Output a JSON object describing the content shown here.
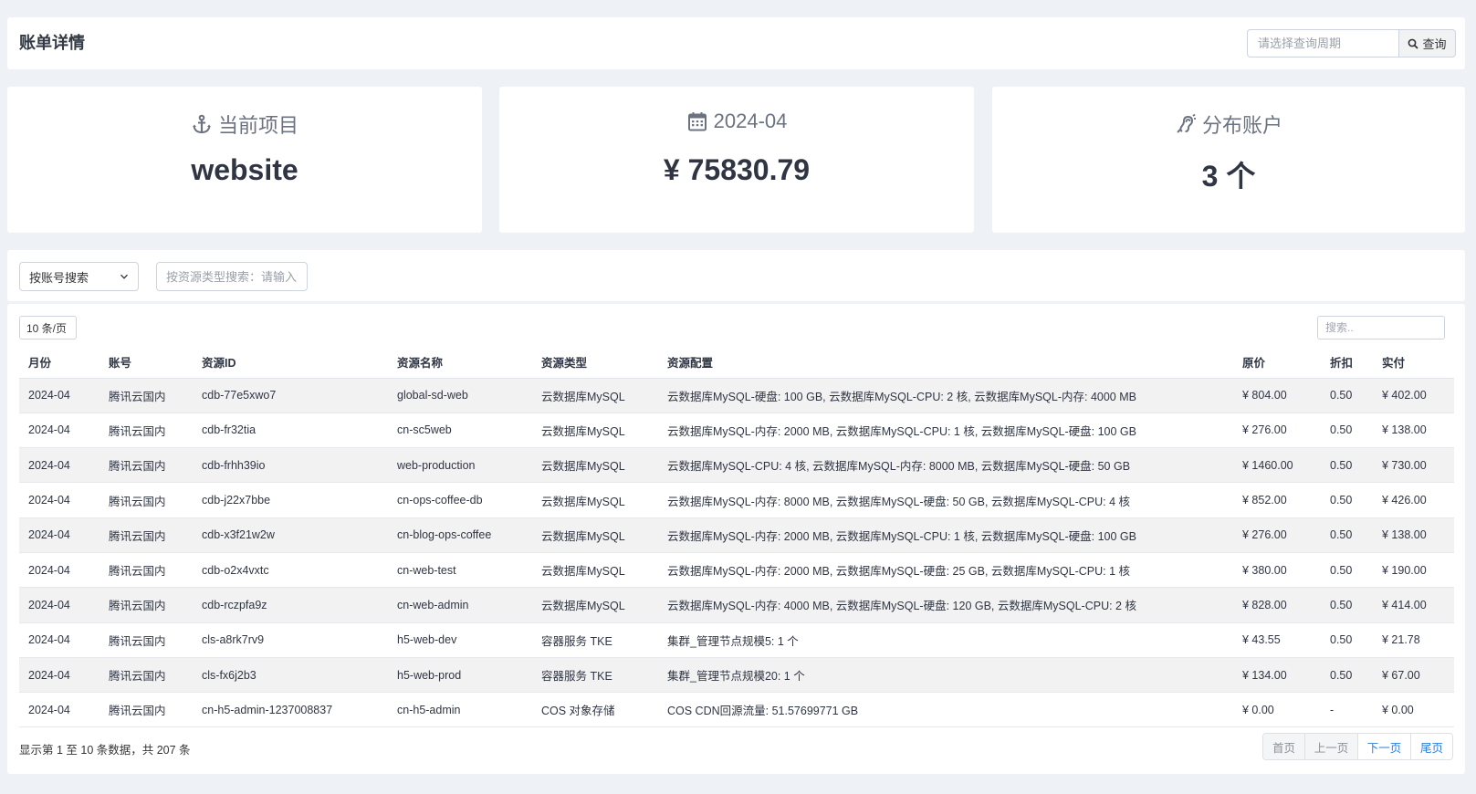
{
  "header": {
    "title": "账单详情",
    "period_placeholder": "请选择查询周期",
    "query_label": "查询",
    "query_icon": "search-icon"
  },
  "cards": {
    "project": {
      "icon": "anchor-icon",
      "label": "当前项目",
      "value": "website"
    },
    "month": {
      "icon": "calendar-icon",
      "label": "2024-04",
      "value": "¥ 75830.79"
    },
    "accounts": {
      "icon": "hearing-icon",
      "label": "分布账户",
      "value": "3 个"
    }
  },
  "filters": {
    "account_select": "按账号搜索",
    "resource_type_placeholder": "按资源类型搜索：请输入资源类型"
  },
  "table": {
    "page_size": "10 条/页",
    "search_placeholder": "搜索..",
    "columns": [
      "月份",
      "账号",
      "资源ID",
      "资源名称",
      "资源类型",
      "资源配置",
      "原价",
      "折扣",
      "实付"
    ],
    "rows": [
      [
        "2024-04",
        "腾讯云国内",
        "cdb-77e5xwo7",
        "global-sd-web",
        "云数据库MySQL",
        "云数据库MySQL-硬盘: 100 GB, 云数据库MySQL-CPU: 2 核, 云数据库MySQL-内存: 4000 MB",
        "¥ 804.00",
        "0.50",
        "¥ 402.00"
      ],
      [
        "2024-04",
        "腾讯云国内",
        "cdb-fr32tia",
        "cn-sc5web",
        "云数据库MySQL",
        "云数据库MySQL-内存: 2000 MB, 云数据库MySQL-CPU: 1 核, 云数据库MySQL-硬盘: 100 GB",
        "¥ 276.00",
        "0.50",
        "¥ 138.00"
      ],
      [
        "2024-04",
        "腾讯云国内",
        "cdb-frhh39io",
        "web-production",
        "云数据库MySQL",
        "云数据库MySQL-CPU: 4 核, 云数据库MySQL-内存: 8000 MB, 云数据库MySQL-硬盘: 50 GB",
        "¥ 1460.00",
        "0.50",
        "¥ 730.00"
      ],
      [
        "2024-04",
        "腾讯云国内",
        "cdb-j22x7bbe",
        "cn-ops-coffee-db",
        "云数据库MySQL",
        "云数据库MySQL-内存: 8000 MB, 云数据库MySQL-硬盘: 50 GB, 云数据库MySQL-CPU: 4 核",
        "¥ 852.00",
        "0.50",
        "¥ 426.00"
      ],
      [
        "2024-04",
        "腾讯云国内",
        "cdb-x3f21w2w",
        "cn-blog-ops-coffee",
        "云数据库MySQL",
        "云数据库MySQL-内存: 2000 MB, 云数据库MySQL-CPU: 1 核, 云数据库MySQL-硬盘: 100 GB",
        "¥ 276.00",
        "0.50",
        "¥ 138.00"
      ],
      [
        "2024-04",
        "腾讯云国内",
        "cdb-o2x4vxtc",
        "cn-web-test",
        "云数据库MySQL",
        "云数据库MySQL-内存: 2000 MB, 云数据库MySQL-硬盘: 25 GB, 云数据库MySQL-CPU: 1 核",
        "¥ 380.00",
        "0.50",
        "¥ 190.00"
      ],
      [
        "2024-04",
        "腾讯云国内",
        "cdb-rczpfa9z",
        "cn-web-admin",
        "云数据库MySQL",
        "云数据库MySQL-内存: 4000 MB, 云数据库MySQL-硬盘: 120 GB, 云数据库MySQL-CPU: 2 核",
        "¥ 828.00",
        "0.50",
        "¥ 414.00"
      ],
      [
        "2024-04",
        "腾讯云国内",
        "cls-a8rk7rv9",
        "h5-web-dev",
        "容器服务 TKE",
        "集群_管理节点规模5: 1 个",
        "¥ 43.55",
        "0.50",
        "¥ 21.78"
      ],
      [
        "2024-04",
        "腾讯云国内",
        "cls-fx6j2b3",
        "h5-web-prod",
        "容器服务 TKE",
        "集群_管理节点规模20: 1 个",
        "¥ 134.00",
        "0.50",
        "¥ 67.00"
      ],
      [
        "2024-04",
        "腾讯云国内",
        "cn-h5-admin-1237008837",
        "cn-h5-admin",
        "COS 对象存储",
        "COS CDN回源流量: 51.57699771 GB",
        "¥ 0.00",
        "-",
        "¥ 0.00"
      ]
    ],
    "info": "显示第 1 至 10 条数据，共 207 条"
  },
  "pagination": {
    "first": "首页",
    "prev": "上一页",
    "next": "下一页",
    "last": "尾页"
  },
  "colors": {
    "background": "#eef1f5",
    "panel": "#ffffff",
    "link_active": "#2f7fd8",
    "text": "#2f3542"
  }
}
